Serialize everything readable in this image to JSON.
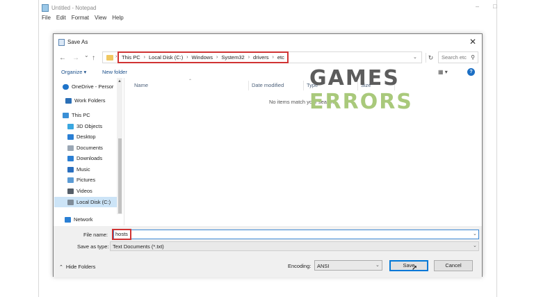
{
  "notepad": {
    "title": "Untitled - Notepad",
    "min_glyph": "–",
    "max_glyph": "□",
    "menu": [
      "File",
      "Edit",
      "Format",
      "View",
      "Help"
    ]
  },
  "dialog": {
    "title": "Save As",
    "close_glyph": "✕",
    "nav": {
      "back": "←",
      "forward": "→",
      "recent": "⌄",
      "up": "↑"
    },
    "address": {
      "crumbs": [
        "This PC",
        "Local Disk (C:)",
        "Windows",
        "System32",
        "drivers",
        "etc"
      ],
      "separator": "›"
    },
    "search": {
      "placeholder": "Search etc"
    },
    "toolbar": {
      "organize": "Organize ▾",
      "new_folder": "New folder",
      "view": "▦ ▾",
      "help": "?"
    },
    "nav_pane": [
      {
        "label": "OneDrive - Persor",
        "icon": "cloud-icon",
        "color": "#1e73c9"
      },
      {
        "label": "Work Folders",
        "icon": "work-folder-icon",
        "color": "#2b6fb6"
      },
      {
        "label": "This PC",
        "icon": "computer-icon",
        "color": "#3a8fd6"
      },
      {
        "label": "3D Objects",
        "icon": "cube-icon",
        "color": "#3aa7e0"
      },
      {
        "label": "Desktop",
        "icon": "desktop-icon",
        "color": "#2a7fd4"
      },
      {
        "label": "Documents",
        "icon": "document-icon",
        "color": "#9aa7b5"
      },
      {
        "label": "Downloads",
        "icon": "download-icon",
        "color": "#2a7fd4"
      },
      {
        "label": "Music",
        "icon": "music-icon",
        "color": "#2a6fbf"
      },
      {
        "label": "Pictures",
        "icon": "pictures-icon",
        "color": "#5b9bd5"
      },
      {
        "label": "Videos",
        "icon": "video-icon",
        "color": "#555e69"
      },
      {
        "label": "Local Disk (C:)",
        "icon": "drive-icon",
        "color": "#7f8c99"
      },
      {
        "label": "Network",
        "icon": "network-icon",
        "color": "#2a7fd4"
      }
    ],
    "columns": [
      "Name",
      "Date modified",
      "Type",
      "Size"
    ],
    "empty_message": "No items match your search.",
    "file_name_label": "File name:",
    "file_name_value": "hosts",
    "save_type_label": "Save as type:",
    "save_type_value": "Text Documents (*.txt)",
    "hide_folders": "Hide Folders",
    "encoding_label": "Encoding:",
    "encoding_value": "ANSI",
    "save_button": "Save",
    "cancel_button": "Cancel"
  },
  "watermark": {
    "line1": "GAMES",
    "line2": "ERRORS"
  },
  "colors": {
    "highlight": "#d03333",
    "accent": "#0078d7",
    "logo_green": "#a9c97b",
    "logo_gray": "#5c5c5c"
  }
}
